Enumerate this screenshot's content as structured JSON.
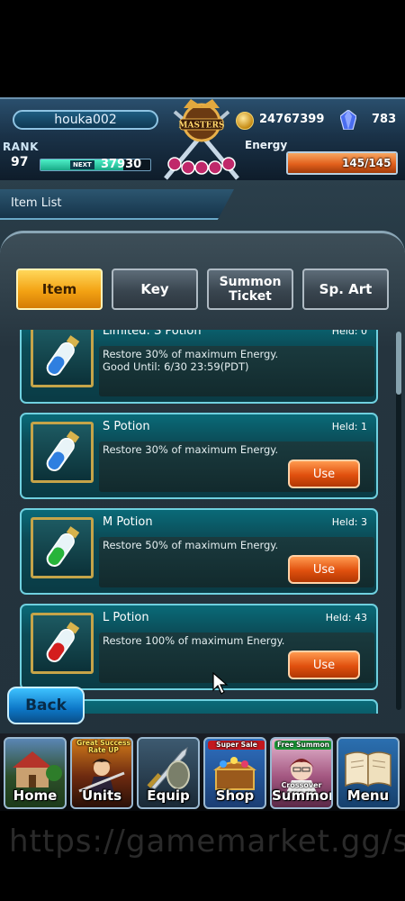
{
  "header": {
    "username": "houka002",
    "rank_label": "RANK",
    "rank": "97",
    "next_label": "NEXT",
    "next_exp": "37930",
    "exp_fraction": 0.75,
    "emblem_text": "MASTERS",
    "coins": "24767399",
    "gems": "783",
    "energy_label": "Energy",
    "energy": "145/145",
    "energy_fraction": 1.0
  },
  "page": {
    "title": "Item List"
  },
  "tabs": [
    {
      "label": "Item",
      "active": true
    },
    {
      "label": "Key",
      "active": false
    },
    {
      "label": "Summon Ticket",
      "active": false
    },
    {
      "label": "Sp. Art",
      "active": false
    }
  ],
  "items": [
    {
      "name": "Limited: S Potion",
      "held": "Held: 0",
      "desc": "Restore 30% of maximum Energy. Good Until: 6/30 23:59(PDT)",
      "use_label": "",
      "liquid": "#2f7fe0"
    },
    {
      "name": "S Potion",
      "held": "Held: 1",
      "desc": "Restore 30% of maximum Energy.",
      "use_label": "Use",
      "liquid": "#2f7fe0"
    },
    {
      "name": "M Potion",
      "held": "Held: 3",
      "desc": "Restore 50% of maximum Energy.",
      "use_label": "Use",
      "liquid": "#27b43a"
    },
    {
      "name": "L Potion",
      "held": "Held: 43",
      "desc": "Restore 100% of maximum Energy.",
      "use_label": "Use",
      "liquid": "#d41d1d"
    }
  ],
  "back_label": "Back",
  "nav": [
    {
      "label": "Home",
      "badge": "",
      "sub": ""
    },
    {
      "label": "Units",
      "badge": "Great Success Rate UP",
      "sub": ""
    },
    {
      "label": "Equip",
      "badge": "",
      "sub": ""
    },
    {
      "label": "Shop",
      "badge": "Super Sale",
      "sub": ""
    },
    {
      "label": "Summon",
      "badge": "Free Summon",
      "sub": "Crossover"
    },
    {
      "label": "Menu",
      "badge": "",
      "sub": ""
    }
  ],
  "watermark": "https://gamemarket.gg/s"
}
